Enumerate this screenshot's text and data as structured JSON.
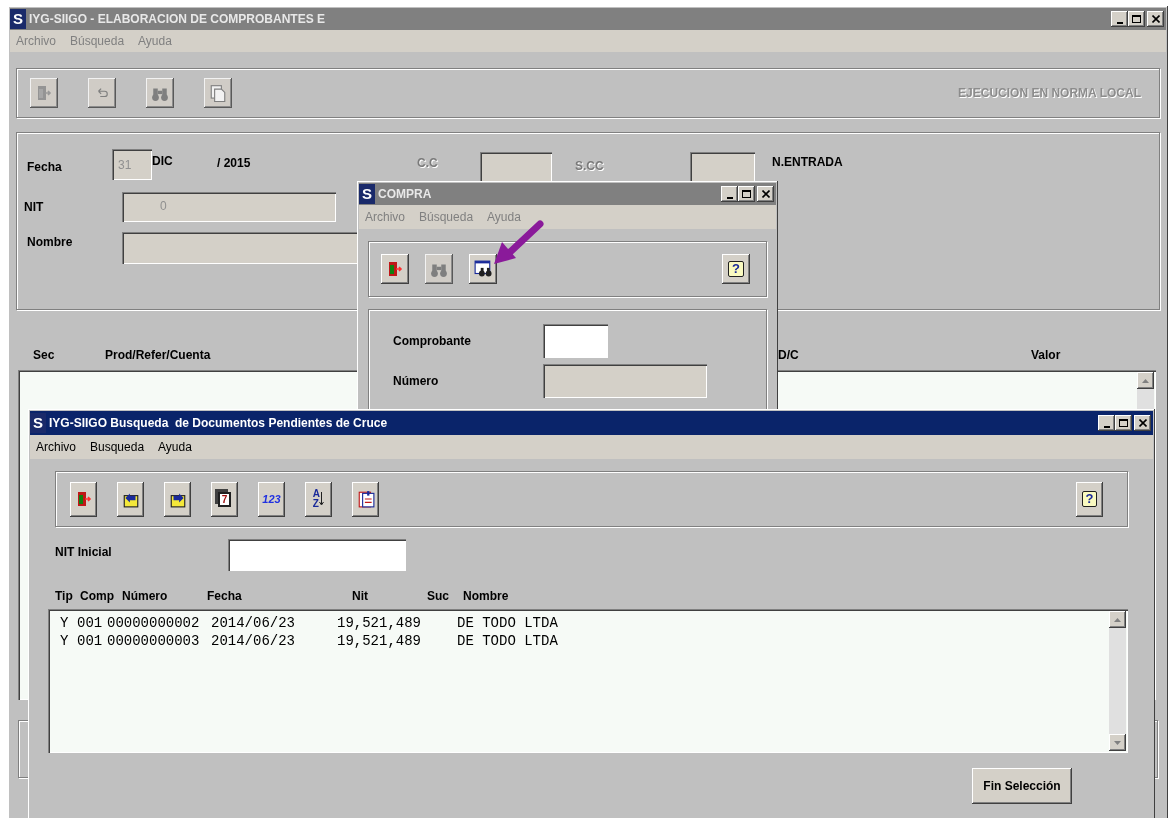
{
  "main_window": {
    "active": false,
    "logo": "S",
    "title": "IYG-SIIGO - ELABORACION DE COMPROBANTES E",
    "menu": [
      "Archivo",
      "Búsqueda",
      "Ayuda"
    ],
    "toolbar": [
      {
        "kind": "exit",
        "disabled": true
      },
      {
        "kind": "undo",
        "disabled": true
      },
      {
        "kind": "find",
        "disabled": true
      },
      {
        "kind": "copy",
        "disabled": true
      }
    ],
    "mode_label": "EJECUCION EN NORMA LOCAL",
    "form": {
      "fecha_label": "Fecha",
      "day": "31",
      "month": "DIC",
      "year": "/ 2015",
      "cc_label": "C.C",
      "scc_label": "S.CC",
      "entrada_label": "N.ENTRADA",
      "nit_label": "NIT",
      "nit_value": "0",
      "nombre_label": "Nombre"
    },
    "grid_columns": [
      "Sec",
      "Prod/Refer/Cuenta",
      "D/C",
      "Valor"
    ]
  },
  "compra_window": {
    "active": false,
    "logo": "S",
    "title": "COMPRA",
    "menu": [
      "Archivo",
      "Búsqueda",
      "Ayuda"
    ],
    "toolbar": [
      {
        "kind": "exit",
        "disabled": false
      },
      {
        "kind": "find",
        "disabled": true
      },
      {
        "kind": "find_doc",
        "disabled": false
      },
      {
        "kind": "help",
        "label": "?",
        "disabled": false
      }
    ],
    "fields": [
      {
        "label": "Comprobante",
        "editable": true
      },
      {
        "label": "Número",
        "editable": false
      }
    ]
  },
  "search_window": {
    "active": true,
    "logo": "S",
    "title": "IYG-SIIGO Busqueda  de Documentos Pendientes de Cruce",
    "menu": [
      "Archivo",
      "Busqueda",
      "Ayuda"
    ],
    "toolbar": [
      {
        "kind": "exit",
        "disabled": false
      },
      {
        "kind": "folder_prev",
        "disabled": false
      },
      {
        "kind": "folder_next",
        "disabled": false
      },
      {
        "kind": "calendar",
        "label": "7",
        "disabled": false
      },
      {
        "kind": "number",
        "label": "123",
        "disabled": false
      },
      {
        "kind": "sort",
        "label": "AZ",
        "disabled": false
      },
      {
        "kind": "clipboard",
        "disabled": false
      },
      {
        "kind": "help",
        "label": "?",
        "disabled": false
      }
    ],
    "nit_label": "NIT Inicial",
    "columns": [
      "Tip",
      "Comp",
      "Número",
      "Fecha",
      "Nit",
      "Suc",
      "Nombre"
    ],
    "rows": [
      {
        "tip": "Y",
        "comp": "001",
        "numero": "00000000002",
        "fecha": "2014/06/23",
        "nit": "19,521,489",
        "nombre": "DE TODO LTDA"
      },
      {
        "tip": "Y",
        "comp": "001",
        "numero": "00000000003",
        "fecha": "2014/06/23",
        "nit": "19,521,489",
        "nombre": "DE TODO LTDA"
      }
    ],
    "button": "Fin Selección"
  }
}
